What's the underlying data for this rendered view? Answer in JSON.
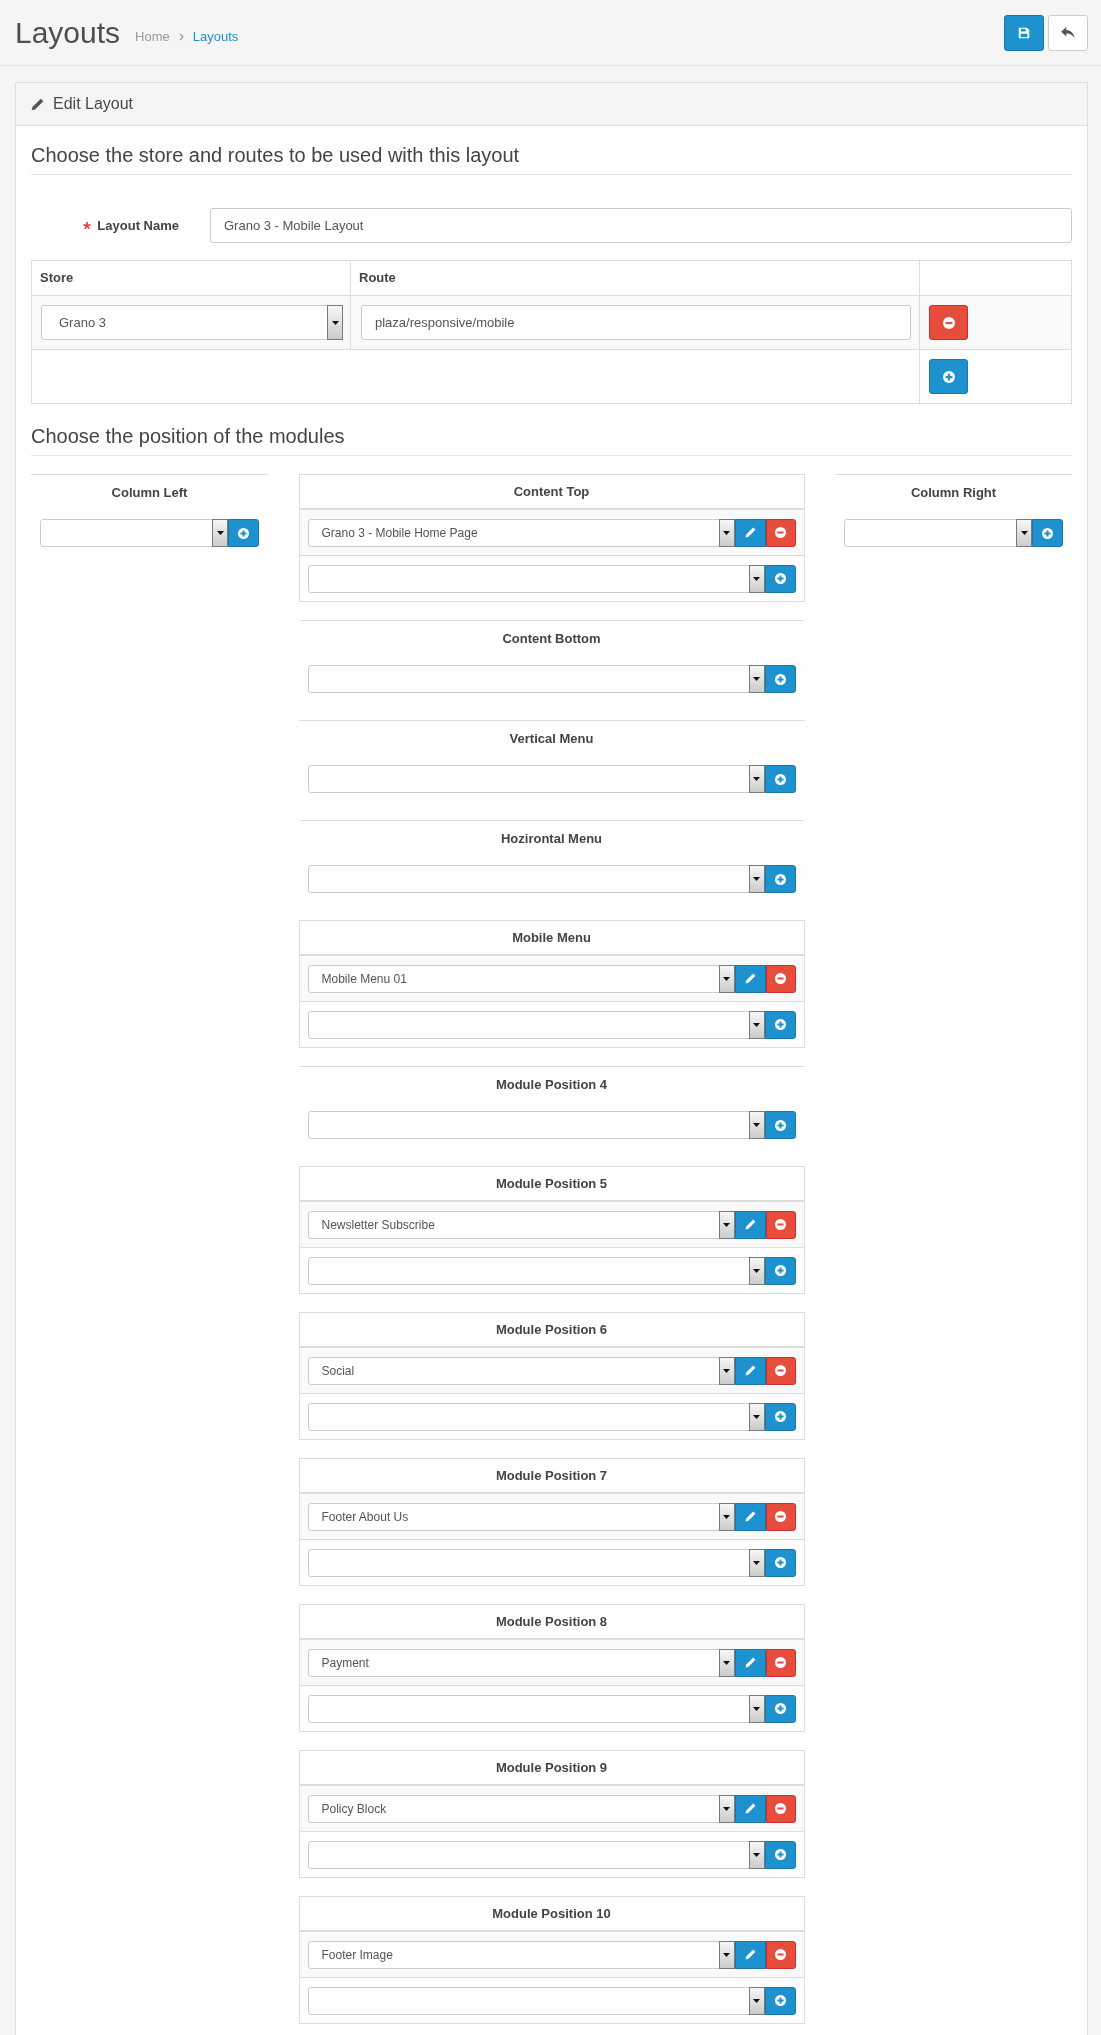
{
  "page_header": {
    "title": "Layouts",
    "breadcrumbs": [
      {
        "label": "Home",
        "current": false
      },
      {
        "label": "Layouts",
        "current": true
      }
    ]
  },
  "panel": {
    "title": "Edit Layout"
  },
  "store_section": {
    "heading": "Choose the store and routes to be used with this layout",
    "layout_name": {
      "label": "Layout Name",
      "required": true,
      "value": "Grano 3 - Mobile Layout"
    },
    "route_table": {
      "columns": [
        "Store",
        "Route"
      ],
      "rows": [
        {
          "store": "Grano 3",
          "route": "plaza/responsive/mobile"
        }
      ]
    }
  },
  "modules_section": {
    "heading": "Choose the position of the modules",
    "columns": [
      {
        "positions": [
          {
            "title": "Column Left"
          }
        ]
      },
      {
        "positions": [
          {
            "title": "Content Top",
            "modules": [
              {
                "name": "Grano 3 - Mobile Home Page"
              }
            ]
          },
          {
            "title": "Content Bottom"
          },
          {
            "title": "Vertical Menu"
          },
          {
            "title": "Hozirontal Menu"
          },
          {
            "title": "Mobile Menu",
            "modules": [
              {
                "name": "Mobile Menu 01"
              }
            ]
          },
          {
            "title": "Module Position 4"
          },
          {
            "title": "Module Position 5",
            "modules": [
              {
                "name": "Newsletter Subscribe"
              }
            ]
          },
          {
            "title": "Module Position 6",
            "modules": [
              {
                "name": "Social"
              }
            ]
          },
          {
            "title": "Module Position 7",
            "modules": [
              {
                "name": "Footer About Us"
              }
            ]
          },
          {
            "title": "Module Position 8",
            "modules": [
              {
                "name": "Payment"
              }
            ]
          },
          {
            "title": "Module Position 9",
            "modules": [
              {
                "name": "Policy Block"
              }
            ]
          },
          {
            "title": "Module Position 10",
            "modules": [
              {
                "name": "Footer Image"
              }
            ]
          }
        ]
      },
      {
        "positions": [
          {
            "title": "Column Right"
          }
        ]
      }
    ]
  }
}
